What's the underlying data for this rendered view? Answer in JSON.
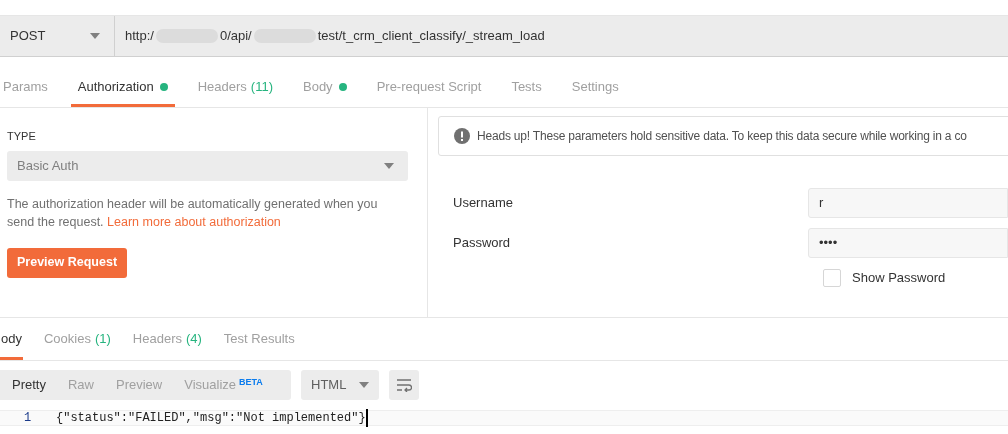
{
  "request": {
    "method": "POST",
    "url_parts": [
      "http:/",
      "0/api/",
      "test/t_crm_client_classify/_stream_load"
    ]
  },
  "request_tabs": [
    {
      "label": "Params",
      "selected": false,
      "dot": false
    },
    {
      "label": "Authorization",
      "selected": true,
      "dot": true
    },
    {
      "label": "Headers",
      "count": "(11)",
      "selected": false,
      "dot": false
    },
    {
      "label": "Body",
      "selected": false,
      "dot": true
    },
    {
      "label": "Pre-request Script",
      "selected": false,
      "dot": false
    },
    {
      "label": "Tests",
      "selected": false,
      "dot": false
    },
    {
      "label": "Settings",
      "selected": false,
      "dot": false
    }
  ],
  "auth": {
    "type_label": "TYPE",
    "type_value": "Basic Auth",
    "description": "The authorization header will be automatically generated when you send the request.",
    "link": "Learn more about authorization",
    "preview_button": "Preview Request"
  },
  "notice": "Heads up! These parameters hold sensitive data. To keep this data secure while working in a co",
  "credentials": [
    {
      "label": "Username",
      "value": "r"
    },
    {
      "label": "Password",
      "value": "••••"
    }
  ],
  "show_password": {
    "label": "Show Password",
    "checked": false
  },
  "response_tabs": [
    {
      "label": "ody",
      "selected": true
    },
    {
      "label": "Cookies",
      "count": "(1)",
      "selected": false
    },
    {
      "label": "Headers",
      "count": "(4)",
      "selected": false
    },
    {
      "label": "Test Results",
      "selected": false
    }
  ],
  "view_modes": [
    {
      "label": "Pretty",
      "selected": true
    },
    {
      "label": "Raw",
      "selected": false
    },
    {
      "label": "Preview",
      "selected": false
    },
    {
      "label": "Visualize",
      "badge": "BETA",
      "selected": false
    }
  ],
  "format": "HTML",
  "code_lines": [
    {
      "number": "1",
      "text": "{\"status\":\"FAILED\",\"msg\":\"Not implemented\"}"
    }
  ]
}
